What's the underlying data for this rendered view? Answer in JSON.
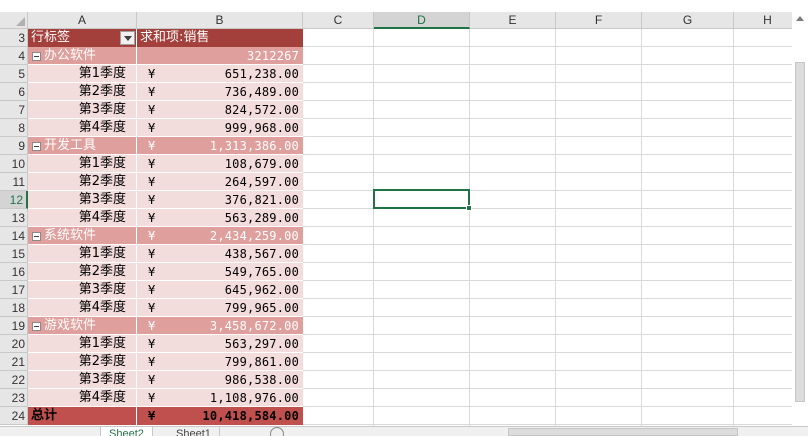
{
  "columns": [
    "A",
    "B",
    "C",
    "D",
    "E",
    "F",
    "G",
    "H"
  ],
  "selected_column": "D",
  "selected_row": "12",
  "rows": [
    "3",
    "4",
    "5",
    "6",
    "7",
    "8",
    "9",
    "10",
    "11",
    "12",
    "13",
    "14",
    "15",
    "16",
    "17",
    "18",
    "19",
    "20",
    "21",
    "22",
    "23",
    "24"
  ],
  "pivot": {
    "row_label_header": "行标签",
    "value_header": "求和项:销售",
    "currency_symbol": "¥",
    "groups": [
      {
        "name": "办公软件",
        "total": "3212267",
        "show_currency": false,
        "quarters": [
          {
            "label": "第1季度",
            "amount": "651,238.00"
          },
          {
            "label": "第2季度",
            "amount": "736,489.00"
          },
          {
            "label": "第3季度",
            "amount": "824,572.00"
          },
          {
            "label": "第4季度",
            "amount": "999,968.00"
          }
        ]
      },
      {
        "name": "开发工具",
        "total": "1,313,386.00",
        "show_currency": true,
        "quarters": [
          {
            "label": "第1季度",
            "amount": "108,679.00"
          },
          {
            "label": "第2季度",
            "amount": "264,597.00"
          },
          {
            "label": "第3季度",
            "amount": "376,821.00"
          },
          {
            "label": "第4季度",
            "amount": "563,289.00"
          }
        ]
      },
      {
        "name": "系统软件",
        "total": "2,434,259.00",
        "show_currency": true,
        "quarters": [
          {
            "label": "第1季度",
            "amount": "438,567.00"
          },
          {
            "label": "第2季度",
            "amount": "549,765.00"
          },
          {
            "label": "第3季度",
            "amount": "645,962.00"
          },
          {
            "label": "第4季度",
            "amount": "799,965.00"
          }
        ]
      },
      {
        "name": "游戏软件",
        "total": "3,458,672.00",
        "show_currency": true,
        "quarters": [
          {
            "label": "第1季度",
            "amount": "563,297.00"
          },
          {
            "label": "第2季度",
            "amount": "799,861.00"
          },
          {
            "label": "第3季度",
            "amount": "986,538.00"
          },
          {
            "label": "第4季度",
            "amount": "1,108,976.00"
          }
        ]
      }
    ],
    "grand_total_label": "总计",
    "grand_total": "10,418,584.00"
  },
  "colors": {
    "header_fill": "#a4403c",
    "group_fill": "#df9f9c",
    "detail_fill": "#f3dddc",
    "total_fill": "#c0504d",
    "selection_accent": "#217346"
  },
  "sheet_tabs": [
    "Sheet2",
    "Sheet1"
  ],
  "active_tab": "Sheet2"
}
